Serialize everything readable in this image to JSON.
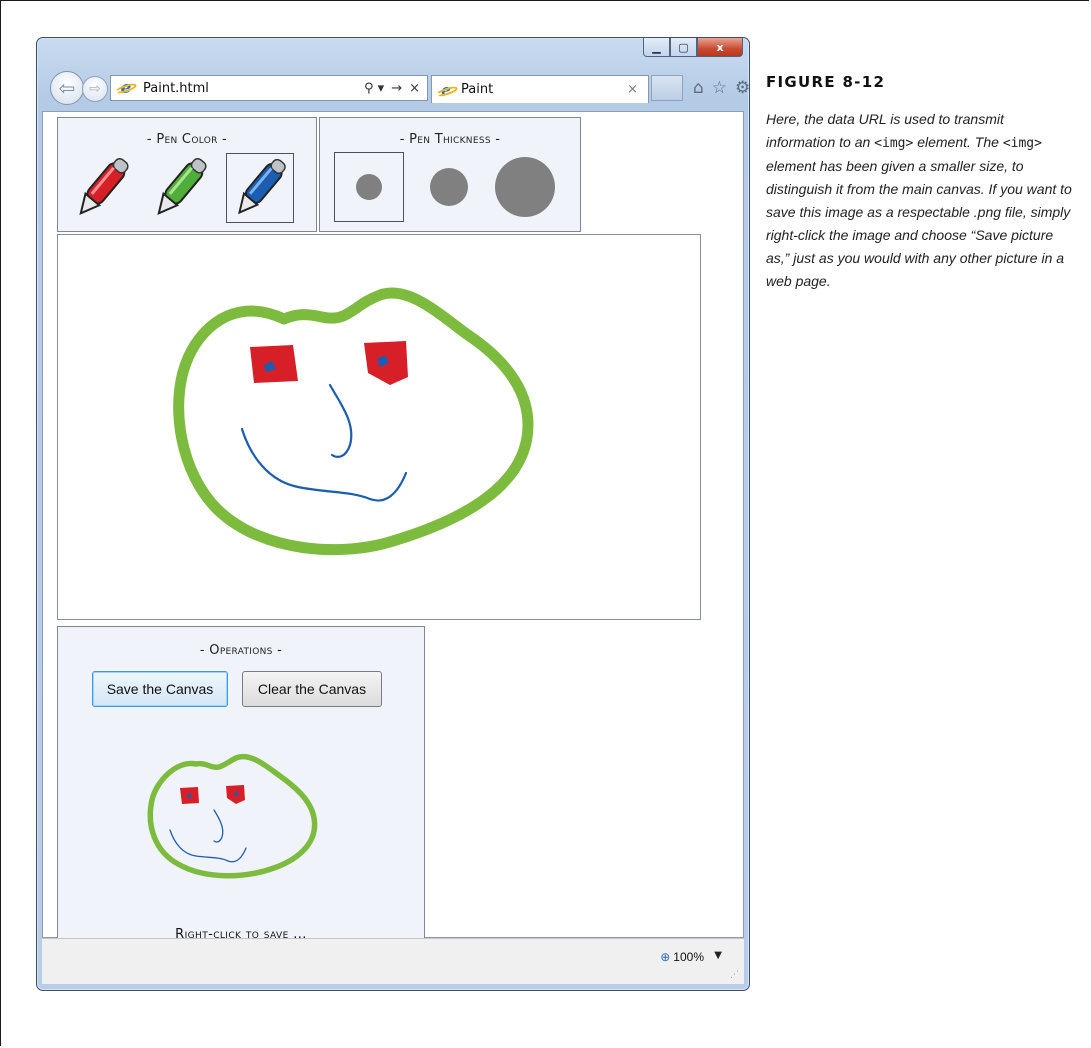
{
  "browser": {
    "window_controls": {
      "minimize": "▁",
      "maximize": "▢",
      "close": "x"
    },
    "back_icon": "back-arrow-icon",
    "forward_icon": "forward-arrow-icon",
    "address": {
      "value": "Paint.html",
      "tools": [
        "⚲ ▾",
        "→",
        "×"
      ]
    },
    "tab": {
      "title": "Paint",
      "close": "×"
    },
    "toolbar_icons": [
      "home-icon",
      "favorites-star-icon",
      "settings-gear-icon"
    ]
  },
  "app": {
    "pen_color": {
      "title": "- Pen Color -",
      "options": [
        {
          "name": "red",
          "color": "#d61f26",
          "selected": false
        },
        {
          "name": "green",
          "color": "#4fae3a",
          "selected": false
        },
        {
          "name": "blue",
          "color": "#1b5db0",
          "selected": true
        }
      ]
    },
    "pen_thickness": {
      "title": "- Pen Thickness -",
      "options": [
        {
          "label": "small",
          "selected": true
        },
        {
          "label": "medium",
          "selected": false
        },
        {
          "label": "large",
          "selected": false
        }
      ]
    },
    "operations": {
      "title": "- Operations -",
      "save_label": "Save the Canvas",
      "clear_label": "Clear the Canvas",
      "footer": "Right-click to save ..."
    },
    "drawing_colors": {
      "outline": "#7dbb3f",
      "eyes": "#d61f26",
      "features": "#1b5db0"
    }
  },
  "statusbar": {
    "zoom": "100%",
    "zoom_arrow": "▼",
    "grip": "⋰"
  },
  "figure": {
    "label": "FIGURE 8-12",
    "caption_parts": {
      "p1": "Here, the data URL is used to transmit information to an ",
      "code1": "<img>",
      "p2": " element. The ",
      "code2": "<img>",
      "p3": " element has been given a smaller size, to distinguish it from the main canvas. If you want to save this image as a respectable .png file, simply right-click the image and choose “Save picture as,” just as you would with any other picture in a web page."
    }
  }
}
